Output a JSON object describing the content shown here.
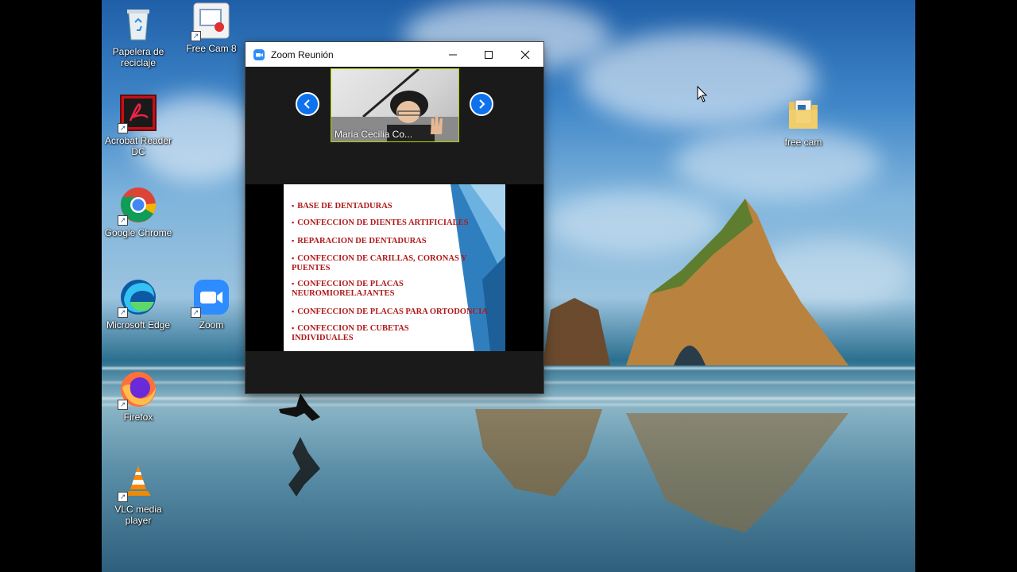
{
  "desktop": {
    "icons": [
      {
        "label": "Papelera de reciclaje",
        "icon": "recycle-bin-icon"
      },
      {
        "label": "Free Cam 8",
        "icon": "free-cam-icon"
      },
      {
        "label": "Acrobat Reader DC",
        "icon": "acrobat-icon"
      },
      {
        "label": "Google Chrome",
        "icon": "chrome-icon"
      },
      {
        "label": "Microsoft Edge",
        "icon": "edge-icon"
      },
      {
        "label": "Zoom",
        "icon": "zoom-icon"
      },
      {
        "label": "Firefox",
        "icon": "firefox-icon"
      },
      {
        "label": "VLC media player",
        "icon": "vlc-icon"
      },
      {
        "label": "free cam",
        "icon": "folder-file-icon"
      }
    ]
  },
  "zoom_window": {
    "title": "Zoom Reunión",
    "participant_name": "Maria Cecilia Co...",
    "slide_bullets": [
      "BASE DE DENTADURAS",
      "CONFECCION DE DIENTES ARTIFICIALES",
      "REPARACION DE DENTADURAS",
      "CONFECCION DE CARILLAS, CORONAS Y PUENTES",
      "CONFECCION DE PLACAS NEUROMIORELAJANTES",
      "CONFECCION DE PLACAS PARA ORTODONCIA",
      "CONFECCION DE CUBETAS INDIVIDUALES"
    ]
  },
  "colors": {
    "zoom_blue": "#2d8cff",
    "slide_text": "#b01818",
    "active_speaker_border": "#a8d600"
  }
}
